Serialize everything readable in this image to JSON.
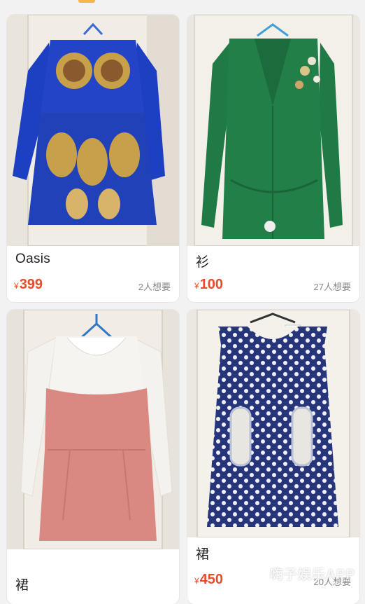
{
  "products": [
    {
      "title": "Oasis",
      "currency": "¥",
      "price": "399",
      "wants": "2人想要"
    },
    {
      "title": "衫",
      "currency": "¥",
      "price": "100",
      "wants": "27人想要"
    },
    {
      "title": "裙",
      "currency": "¥",
      "price": "",
      "wants": ""
    },
    {
      "title": "裙",
      "currency": "¥",
      "price": "450",
      "wants": "20人想要"
    }
  ],
  "watermark": "嗨子娱乐APP",
  "colors": {
    "price": "#e74c28",
    "accent": "#f5b74a"
  },
  "icons": [
    "hanger-icon"
  ]
}
